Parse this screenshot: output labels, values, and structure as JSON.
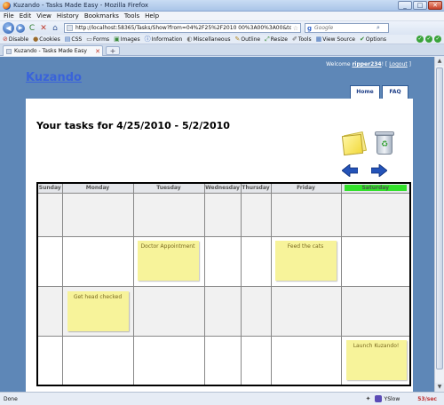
{
  "window": {
    "title": "Kuzando - Tasks Made Easy - Mozilla Firefox",
    "min": "_",
    "max": "□",
    "close": "✕"
  },
  "menu": [
    "File",
    "Edit",
    "View",
    "History",
    "Bookmarks",
    "Tools",
    "Help"
  ],
  "nav": {
    "back": "◀",
    "forward": "▶",
    "reload": "C",
    "stop": "✕",
    "home": "⌂",
    "url": "http://localhost:58365/Tasks/Show?from=04%2F25%2F2010 00%3A00%3A00&to=05%2F02%2F2010 00%",
    "star": "☆",
    "search_placeholder": "Google",
    "search_engine": "g",
    "search_icon": "⌕"
  },
  "devtoolbar": {
    "items": [
      "Disable",
      "Cookies",
      "CSS",
      "Forms",
      "Images",
      "Information",
      "Miscellaneous",
      "Outline",
      "Resize",
      "Tools",
      "View Source",
      "Options"
    ],
    "check": "✓"
  },
  "tabs": {
    "active": "Kuzando - Tasks Made Easy",
    "close": "✕",
    "new": "+"
  },
  "site": {
    "logo": "Kuzando",
    "welcome_prefix": "Welcome",
    "username": "ripper234",
    "logout_open": "! [",
    "logout": "Logout",
    "logout_close": "]",
    "nav": [
      "Home",
      "FAQ"
    ],
    "heading": "Your tasks for 4/25/2010 - 5/2/2010",
    "recycle": "♻"
  },
  "calendar": {
    "days": [
      "Sunday",
      "Monday",
      "Tuesday",
      "Wednesday",
      "Thursday",
      "Friday",
      "Saturday"
    ],
    "today": "Saturday",
    "rows": 4,
    "notes": [
      {
        "row": 2,
        "day": "Tuesday",
        "text": "Doctor Appointment"
      },
      {
        "row": 2,
        "day": "Friday",
        "text": "Feed the cats"
      },
      {
        "row": 3,
        "day": "Monday",
        "text": "Get head checked"
      },
      {
        "row": 4,
        "day": "Saturday",
        "text": "Launch Kuzando!"
      }
    ]
  },
  "status": {
    "text": "Done",
    "yslow": "YSlow",
    "perf": "53/sec"
  }
}
